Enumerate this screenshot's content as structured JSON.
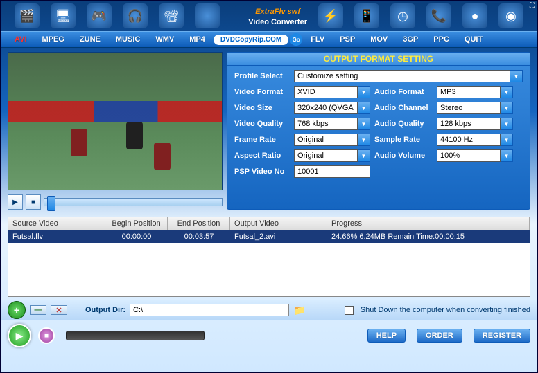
{
  "brand": {
    "name": "ExtraFlv swf",
    "sub": "Video Converter"
  },
  "nav": {
    "items": [
      "AVI",
      "MPEG",
      "ZUNE",
      "MUSIC",
      "WMV",
      "MP4"
    ],
    "pill": "DVDCopyRip.COM",
    "go": "Go",
    "items2": [
      "FLV",
      "PSP",
      "MOV",
      "3GP",
      "PPC",
      "QUIT"
    ],
    "active": "AVI"
  },
  "settings": {
    "title": "OUTPUT FORMAT SETTING",
    "profile_lbl": "Profile Select",
    "profile": "Customize setting",
    "vformat_lbl": "Video Format",
    "vformat": "XVID",
    "aformat_lbl": "Audio Format",
    "aformat": "MP3",
    "vsize_lbl": "Video Size",
    "vsize": "320x240 (QVGA)",
    "achan_lbl": "Audio Channel",
    "achan": "Stereo",
    "vqual_lbl": "Video Quality",
    "vqual": "768 kbps",
    "aqual_lbl": "Audio Quality",
    "aqual": "128 kbps",
    "frate_lbl": "Frame Rate",
    "frate": "Original",
    "srate_lbl": "Sample Rate",
    "srate": "44100 Hz",
    "aspect_lbl": "Aspect Ratio",
    "aspect": "Original",
    "avol_lbl": "Audio Volume",
    "avol": "100%",
    "psp_lbl": "PSP Video No",
    "psp": "10001"
  },
  "table": {
    "headers": {
      "c0": "Source Video",
      "c1": "Begin Position",
      "c2": "End Position",
      "c3": "Output Video",
      "c4": "Progress"
    },
    "row": {
      "src": "Futsal.flv",
      "begin": "00:00:00",
      "end": "00:03:57",
      "out": "Futsal_2.avi",
      "prog": "24.66%   6.24MB   Remain Time:00:00:15"
    }
  },
  "bottom": {
    "out_lbl": "Output Dir:",
    "out_val": "C:\\",
    "shutdown": "Shut Down the computer when converting finished",
    "help": "HELP",
    "order": "ORDER",
    "register": "REGISTER"
  }
}
